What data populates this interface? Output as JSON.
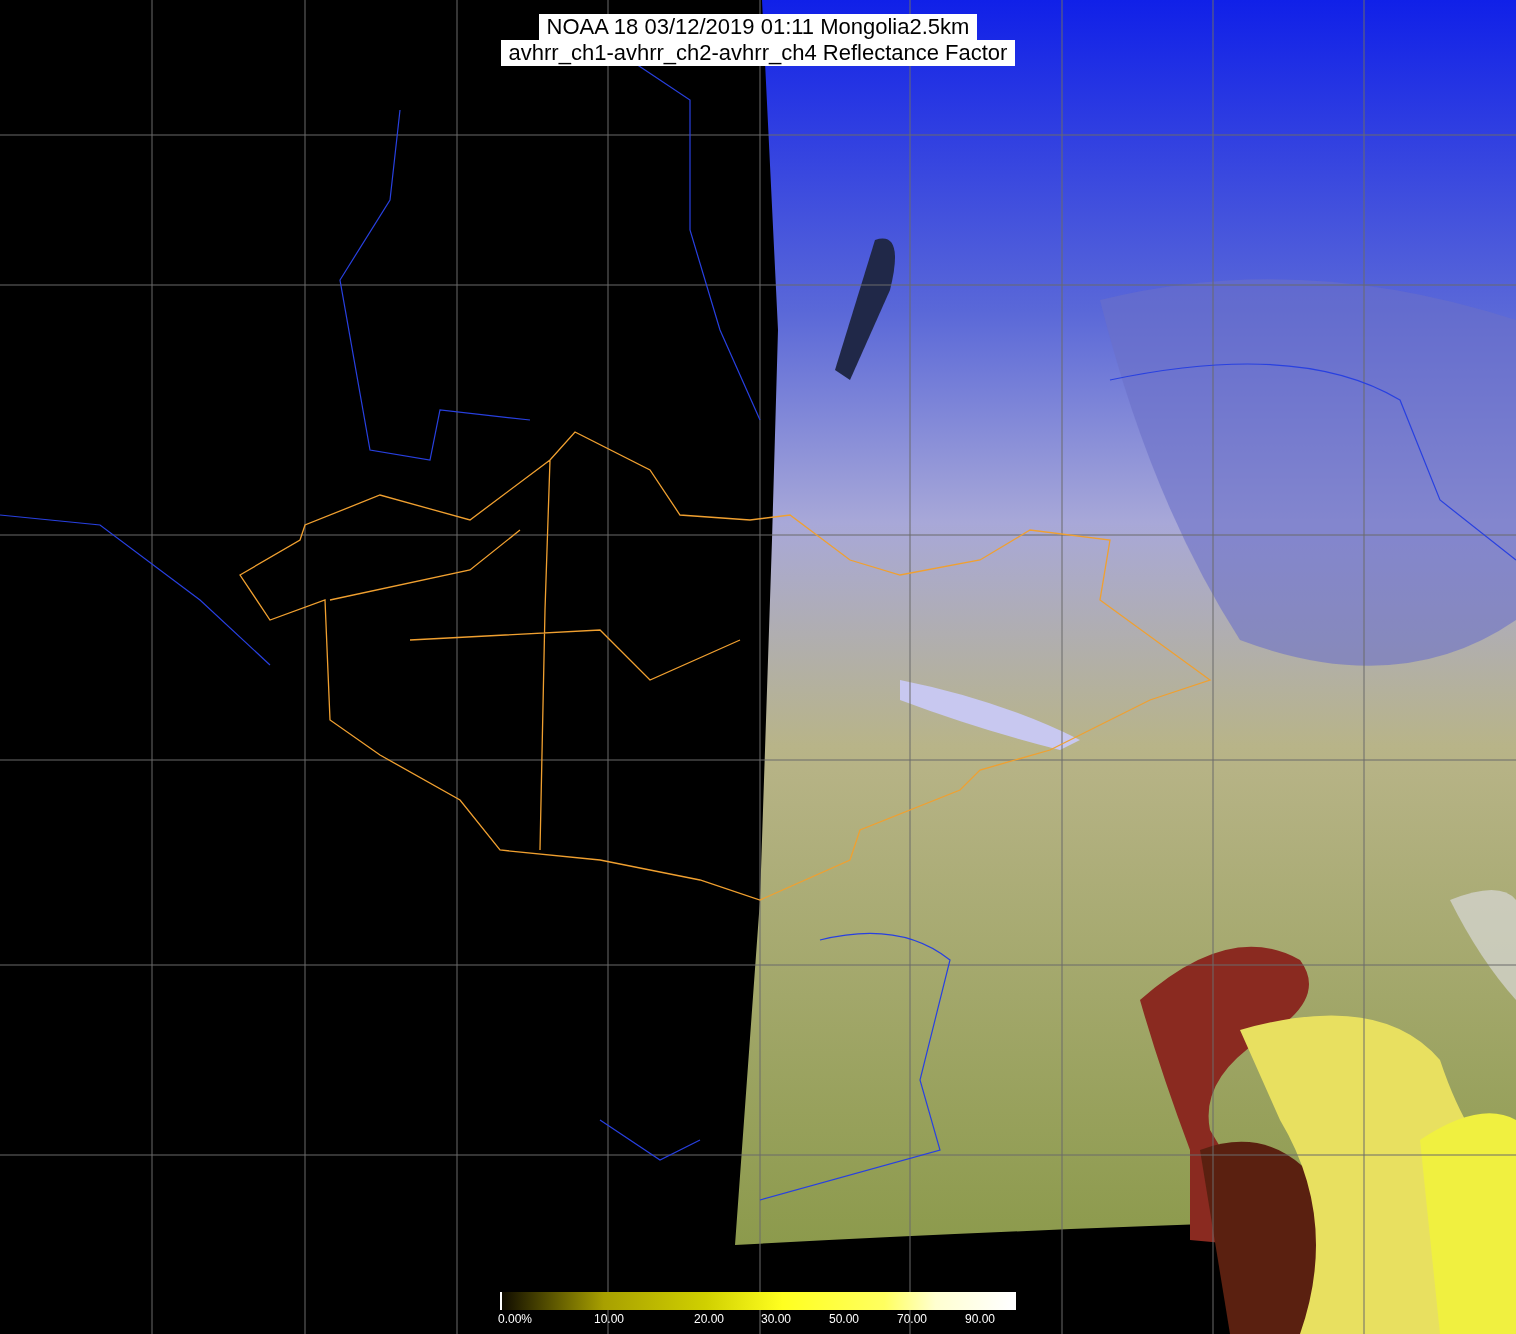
{
  "title": {
    "lines": [
      "NOAA 18 03/12/2019 01:11 Mongolia2.5km",
      "avhrr_ch1-avhrr_ch2-avhrr_ch4 Reflectance Factor"
    ]
  },
  "color_bar": {
    "labels": [
      "0.00%",
      "10.00",
      "20.00",
      "30.00",
      "50.00",
      "70.00",
      "90.00"
    ]
  }
}
